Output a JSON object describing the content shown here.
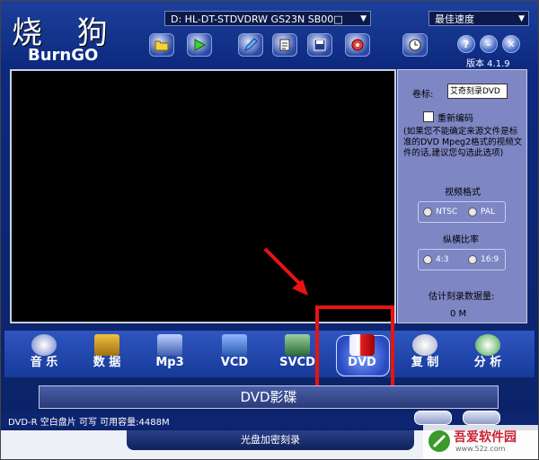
{
  "app": {
    "title_cn": "烧 狗",
    "title_en": "BurnGO",
    "version": "版本 4.1.9"
  },
  "drive_select": {
    "value": "D: HL-DT-STDVDRW  GS23N    SB00□"
  },
  "speed_select": {
    "value": "最佳速度"
  },
  "toolbar": {
    "buttons": [
      "open-folder",
      "play",
      "edit",
      "copy",
      "save",
      "burn"
    ],
    "right_buttons": [
      "timer",
      "help",
      "minimize",
      "close"
    ],
    "help_label": "?",
    "min_label": "–",
    "close_label": "✕"
  },
  "settings": {
    "label_title": "卷标:",
    "title_value": "艾奇刻录DVD",
    "reencode_label": "重新编码",
    "note": "(如果您不能确定来源文件是标准的DVD Mpeg2格式的视频文件的话,建议您勾选此选项)",
    "video_format_label": "视频格式",
    "ntsc": "NTSC",
    "pal": "PAL",
    "aspect_label": "纵横比率",
    "ratio_43": "4:3",
    "ratio_169": "16:9",
    "estimate_label": "估计刻录数据量:",
    "estimate_value": "0 M"
  },
  "modes": [
    {
      "label": "音 乐"
    },
    {
      "label": "数 据"
    },
    {
      "label": "Mp3"
    },
    {
      "label": "VCD"
    },
    {
      "label": "SVCD"
    },
    {
      "label": "DVD"
    },
    {
      "label": "复 制"
    },
    {
      "label": "分 析"
    }
  ],
  "banner": {
    "text": "DVD影碟"
  },
  "status": {
    "text": "DVD-R 空白盘片 可写 可用容量:4488M"
  },
  "bottom": {
    "encrypt": "光盘加密刻录"
  },
  "watermark": {
    "text1": "吾爱软件园",
    "text2": "www.52z.com"
  }
}
